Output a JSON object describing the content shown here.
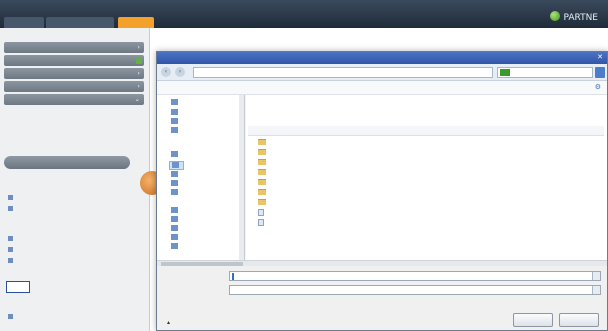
{
  "header": {
    "title": "",
    "tabs": [
      "",
      "",
      ""
    ],
    "brand": "PARTNE"
  },
  "sidebar": {
    "heading": "",
    "items": [
      "",
      "",
      "",
      "",
      ""
    ],
    "subitem": "",
    "pill": "",
    "sections": [
      "",
      ""
    ],
    "links": [
      "",
      "",
      "",
      "",
      "",
      "",
      ""
    ]
  },
  "main": {
    "breadcrumb": "",
    "labels": [
      "",
      "",
      "",
      ""
    ]
  },
  "dialog": {
    "title": "",
    "address": "",
    "search_placeholder": "",
    "command_bar": "",
    "library_title": "",
    "library_subtitle": "",
    "arrange_by": "",
    "columns": [
      "",
      "",
      "",
      ""
    ],
    "nav_items": [
      "",
      "",
      "",
      "",
      "",
      "",
      "",
      "",
      "",
      "",
      "",
      "",
      "",
      ""
    ],
    "files": [
      {
        "name": "",
        "date": "",
        "type": "",
        "size": ""
      },
      {
        "name": "",
        "date": "",
        "type": "",
        "size": ""
      },
      {
        "name": "",
        "date": "",
        "type": "",
        "size": ""
      },
      {
        "name": "",
        "date": "",
        "type": "",
        "size": ""
      },
      {
        "name": "",
        "date": "",
        "type": "",
        "size": ""
      },
      {
        "name": "",
        "date": "",
        "type": "",
        "size": ""
      },
      {
        "name": "",
        "date": "",
        "type": "",
        "size": ""
      },
      {
        "name": "",
        "date": "",
        "type": "",
        "size": ""
      },
      {
        "name": "",
        "date": "",
        "type": "",
        "size": ""
      }
    ],
    "filename_label": "",
    "filename_value": "",
    "filetype_label": "",
    "filetype_value": "",
    "hide_folders": "",
    "save_label": "",
    "cancel_label": ""
  },
  "colors": {
    "header_bg": "#1f2b39",
    "accent_orange": "#f3a12b",
    "dialog_title": "#2f56a8",
    "selection": "#3470c6"
  }
}
